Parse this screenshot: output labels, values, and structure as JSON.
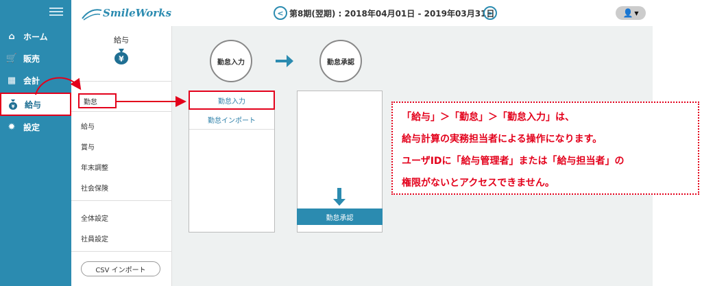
{
  "header": {
    "logo_text": "SmileWorks",
    "period": "第8期(翌期) : 2018年04月01日 - 2019年03月31日",
    "prev_icon": "chevron-left-icon",
    "next_icon": "chevron-right-icon",
    "user_icon": "user-icon"
  },
  "sidebar": {
    "items": [
      {
        "label": "ホーム",
        "icon": "home-icon"
      },
      {
        "label": "販売",
        "icon": "cart-icon"
      },
      {
        "label": "会計",
        "icon": "calculator-icon"
      },
      {
        "label": "給与",
        "icon": "moneybag-icon"
      },
      {
        "label": "設定",
        "icon": "gear-icon"
      }
    ]
  },
  "submenu": {
    "title": "給与",
    "items": [
      "勤怠",
      "給与",
      "賞与",
      "年末調整",
      "社会保険",
      "全体設定",
      "社員設定"
    ],
    "csv_button": "CSV インポート"
  },
  "flow": {
    "step1": "勤怠入力",
    "step2": "勤怠承認",
    "panel1_items": [
      "勤怠入力",
      "勤怠インポート"
    ],
    "panel2_button": "勤怠承認"
  },
  "callout": {
    "lines": [
      "「給与」＞「勤怠」＞「勤怠入力」は、",
      "給与計算の実務担当者による操作になります。",
      "ユーザIDに「給与管理者」または「給与担当者」の",
      "権限がないとアクセスできません。"
    ]
  },
  "colors": {
    "brand": "#2b8bb0",
    "highlight": "#e3001b",
    "main_bg": "#eef1f1"
  }
}
